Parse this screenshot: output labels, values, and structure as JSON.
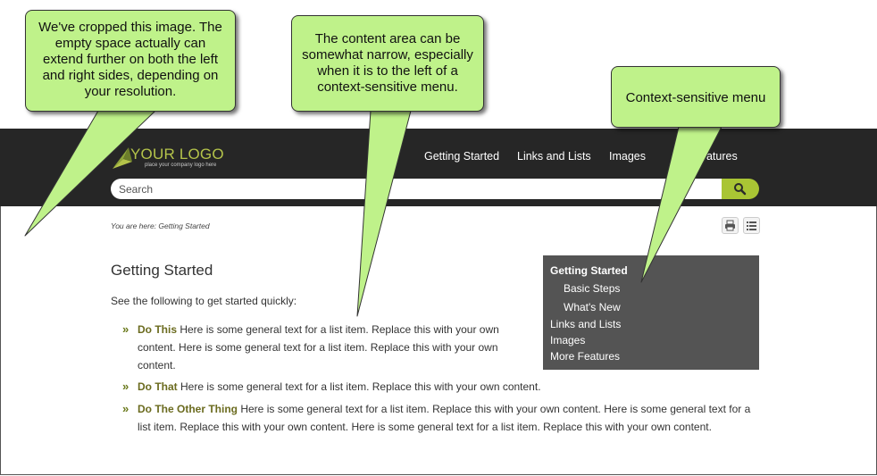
{
  "header": {
    "logo_text": "YOUR LOGO",
    "logo_tagline": "place your company logo here",
    "nav": [
      "Getting Started",
      "Links and Lists",
      "Images",
      "eatures"
    ]
  },
  "search": {
    "placeholder": "Search"
  },
  "breadcrumb": "You are here: Getting Started",
  "main": {
    "title": "Getting Started",
    "intro": "See the following to get started quickly:",
    "list": [
      {
        "term": "Do This",
        "lines": [
          "Here is some general text for a list item. Replace this with your own",
          "content. Here is some general text for a list item. Replace this with your own",
          "content."
        ]
      },
      {
        "term": "Do That",
        "lines": [
          "Here is some general text for a list item. Replace this with your own content."
        ]
      },
      {
        "term": "Do The Other Thing",
        "lines": [
          "Here is some general text for a list item. Replace this with your own content. Here is some general text for a",
          "list item. Replace this with your own content. Here is some general text for a list item. Replace this with your own content."
        ]
      }
    ]
  },
  "context_menu": {
    "items": [
      "Getting Started",
      "Basic Steps",
      "What's New",
      "Links and Lists",
      "Images",
      "More Features"
    ]
  },
  "callouts": {
    "left": [
      "We've cropped this image. The",
      "empty space actually can",
      "extend further on both the left",
      "and right sides, depending on",
      "your resolution."
    ],
    "middle": [
      "The content area can be",
      "somewhat narrow, especially",
      "when it is to the left of a",
      "context-sensitive menu."
    ],
    "right": [
      "Context-sensitive menu"
    ]
  },
  "colors": {
    "header_bg": "#262626",
    "accent": "#a9c534",
    "menu_bg": "#545454",
    "callout": "#bff28a"
  }
}
